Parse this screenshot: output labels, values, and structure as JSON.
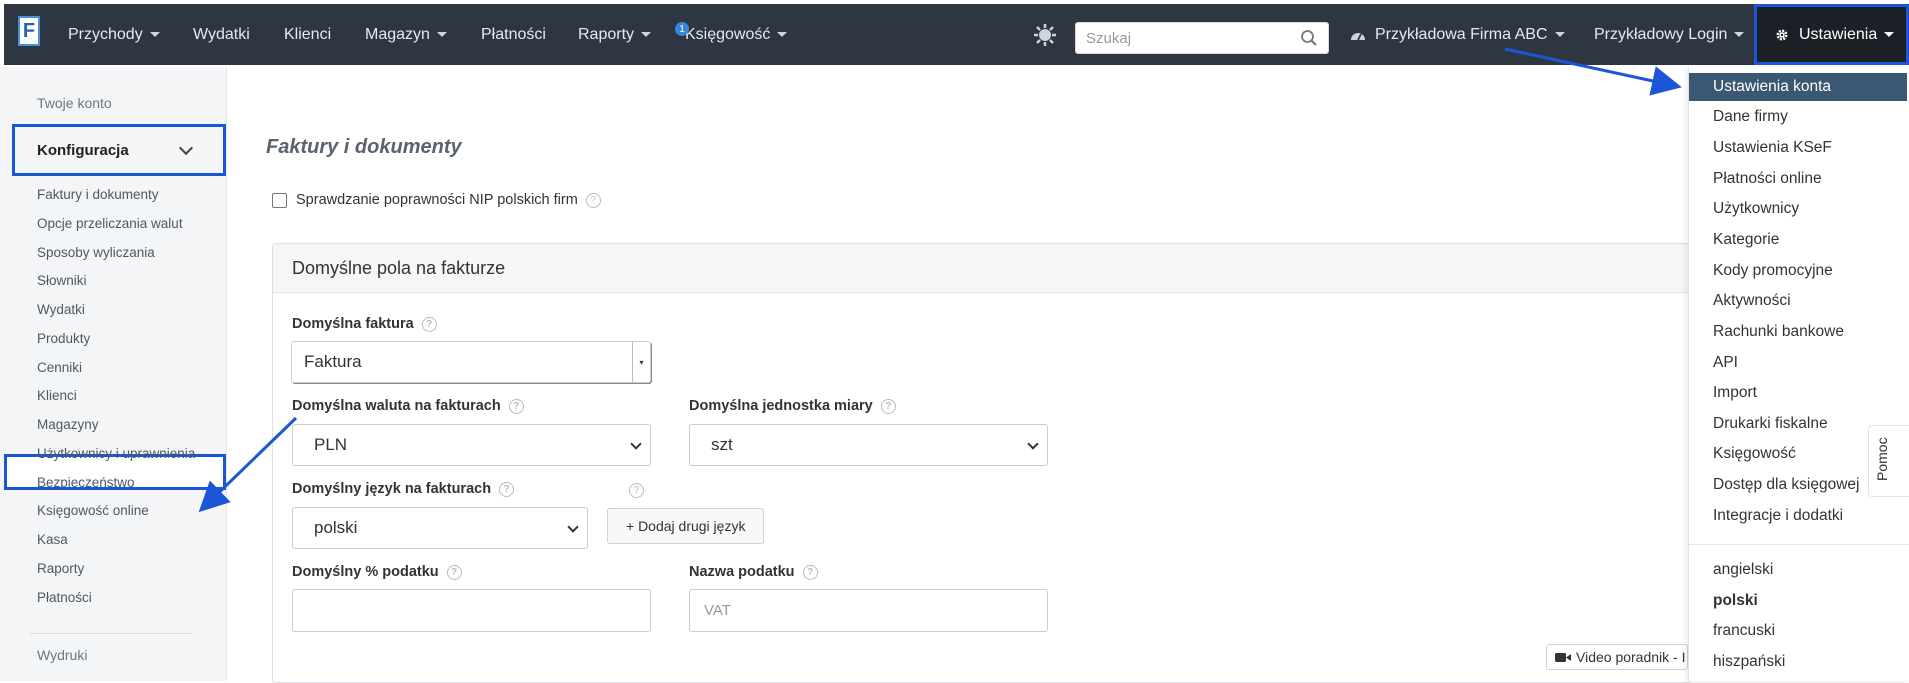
{
  "nav": {
    "logo": "F",
    "items": [
      {
        "label": "Przychody",
        "dropdown": true
      },
      {
        "label": "Wydatki",
        "dropdown": false
      },
      {
        "label": "Klienci",
        "dropdown": false
      },
      {
        "label": "Magazyn",
        "dropdown": true
      },
      {
        "label": "Płatności",
        "dropdown": false
      },
      {
        "label": "Raporty",
        "dropdown": true
      },
      {
        "label": "Księgowość",
        "dropdown": true,
        "badge": "1"
      }
    ],
    "search_placeholder": "Szukaj",
    "company": "Przykładowa Firma ABC",
    "login": "Przykładowy Login",
    "settings": "Ustawienia"
  },
  "sidebar": {
    "account": "Twoje konto",
    "config": "Konfiguracja",
    "items": [
      "Faktury i dokumenty",
      "Opcje przeliczania walut",
      "Sposoby wyliczania",
      "Słowniki",
      "Wydatki",
      "Produkty",
      "Cenniki",
      "Klienci",
      "Magazyny",
      "Użytkownicy i uprawnienia",
      "Bezpieczeństwo",
      "Księgowość online",
      "Kasa",
      "Raporty",
      "Płatności"
    ],
    "prints": "Wydruki"
  },
  "main": {
    "title": "Faktury i dokumenty",
    "nip_check": "Sprawdzanie poprawności NIP polskich firm",
    "panel_title": "Domyślne pola na fakturze",
    "default_invoice_label": "Domyślna faktura",
    "default_invoice_value": "Faktura",
    "currency_label": "Domyślna waluta na fakturach",
    "currency_value": "PLN",
    "unit_label": "Domyślna jednostka miary",
    "unit_value": "szt",
    "language_label": "Domyślny język na fakturach",
    "language_value": "polski",
    "add_language": "+ Dodaj drugi język",
    "tax_label": "Domyślny % podatku",
    "tax_value": "",
    "tax_name_label": "Nazwa podatku",
    "tax_name_placeholder": "VAT",
    "video": "Video poradnik - I"
  },
  "dropdown": {
    "items": [
      "Ustawienia konta",
      "Dane firmy",
      "Ustawienia KSeF",
      "Płatności online",
      "Użytkownicy",
      "Kategorie",
      "Kody promocyjne",
      "Aktywności",
      "Rachunki bankowe",
      "API",
      "Import",
      "Drukarki fiskalne",
      "Księgowość",
      "Dostęp dla księgowej",
      "Integracje i dodatki"
    ],
    "languages": [
      "angielski",
      "polski",
      "francuski",
      "hiszpański"
    ]
  },
  "help_tab": "Pomoc",
  "colors": {
    "navbar": "#2e3641",
    "highlight": "#1a56d6",
    "active_menu": "#3b5873"
  }
}
